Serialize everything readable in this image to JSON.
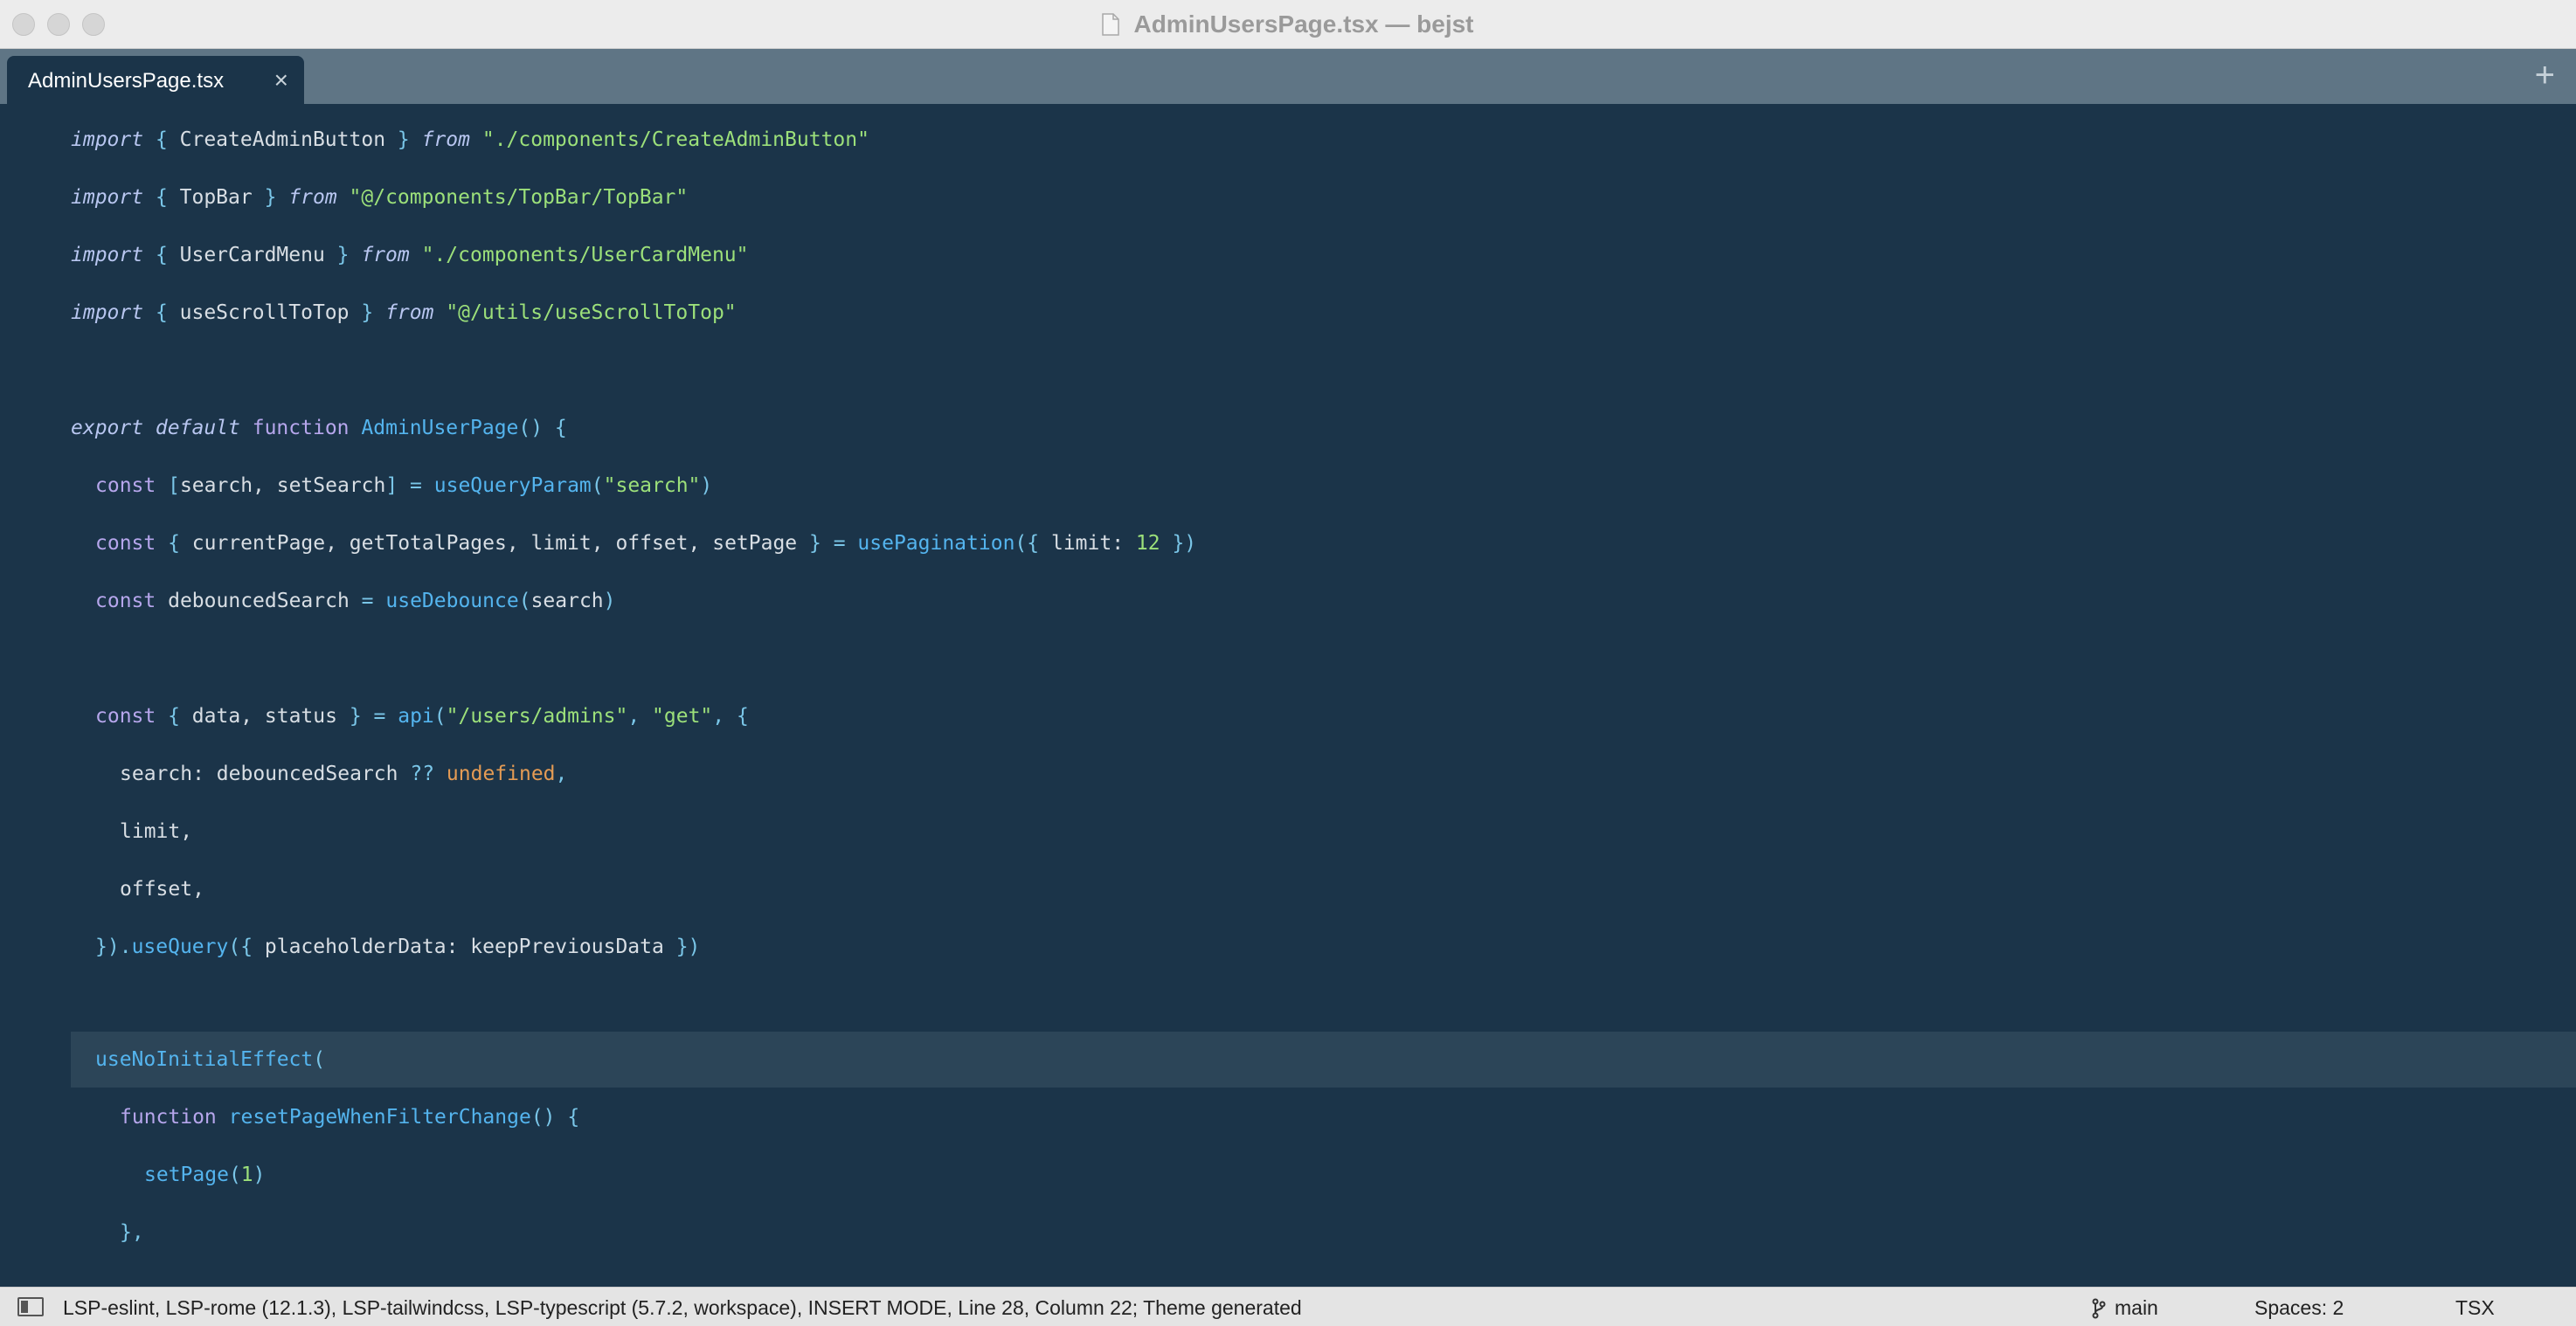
{
  "window": {
    "title": "AdminUsersPage.tsx — bejst"
  },
  "tabs": {
    "active_label": "AdminUsersPage.tsx",
    "close_glyph": "×",
    "add_glyph": "+"
  },
  "editor": {
    "lines": [
      [
        "import",
        " { ",
        "CreateAdminButton",
        " } ",
        "from",
        " ",
        "\"./components/CreateAdminButton\""
      ],
      [
        "import",
        " { ",
        "TopBar",
        " } ",
        "from",
        " ",
        "\"@/components/TopBar/TopBar\""
      ],
      [
        "import",
        " { ",
        "UserCardMenu",
        " } ",
        "from",
        " ",
        "\"./components/UserCardMenu\""
      ],
      [
        "import",
        " { ",
        "useScrollToTop",
        " } ",
        "from",
        " ",
        "\"@/utils/useScrollToTop\""
      ],
      [
        "export default",
        " ",
        "function",
        " ",
        "AdminUserPage",
        "() {"
      ],
      [
        "const",
        " [",
        "search, setSearch",
        "] = ",
        "useQueryParam",
        "(",
        "\"search\"",
        ")"
      ],
      [
        "const",
        " { ",
        "currentPage, getTotalPages, limit, offset, setPage",
        " } = ",
        "usePagination",
        "({ ",
        "limit: ",
        "12",
        " })"
      ],
      [
        "const",
        " ",
        "debouncedSearch",
        " = ",
        "useDebounce",
        "(",
        "search",
        ")"
      ],
      [
        "const",
        " { ",
        "data, status",
        " } = ",
        "api",
        "(",
        "\"/users/admins\"",
        ", ",
        "\"get\"",
        ", {"
      ],
      [
        "search: debouncedSearch ",
        "??",
        " ",
        "undefined",
        ","
      ],
      [
        "limit,"
      ],
      [
        "offset,"
      ],
      [
        "})",
        ".",
        "useQuery",
        "({ ",
        "placeholderData: keepPreviousData",
        " })"
      ],
      [
        "useNoInitialEffect",
        "("
      ],
      [
        "function",
        " ",
        "resetPageWhenFilterChange",
        "() {"
      ],
      [
        "setPage",
        "(",
        "1",
        ")"
      ],
      [
        "},"
      ]
    ]
  },
  "statusbar": {
    "info": "LSP-eslint, LSP-rome (12.1.3), LSP-tailwindcss, LSP-typescript (5.7.2, workspace), INSERT MODE, Line 28, Column 22; Theme generated",
    "branch": "main",
    "spaces": "Spaces: 2",
    "language": "TSX"
  }
}
